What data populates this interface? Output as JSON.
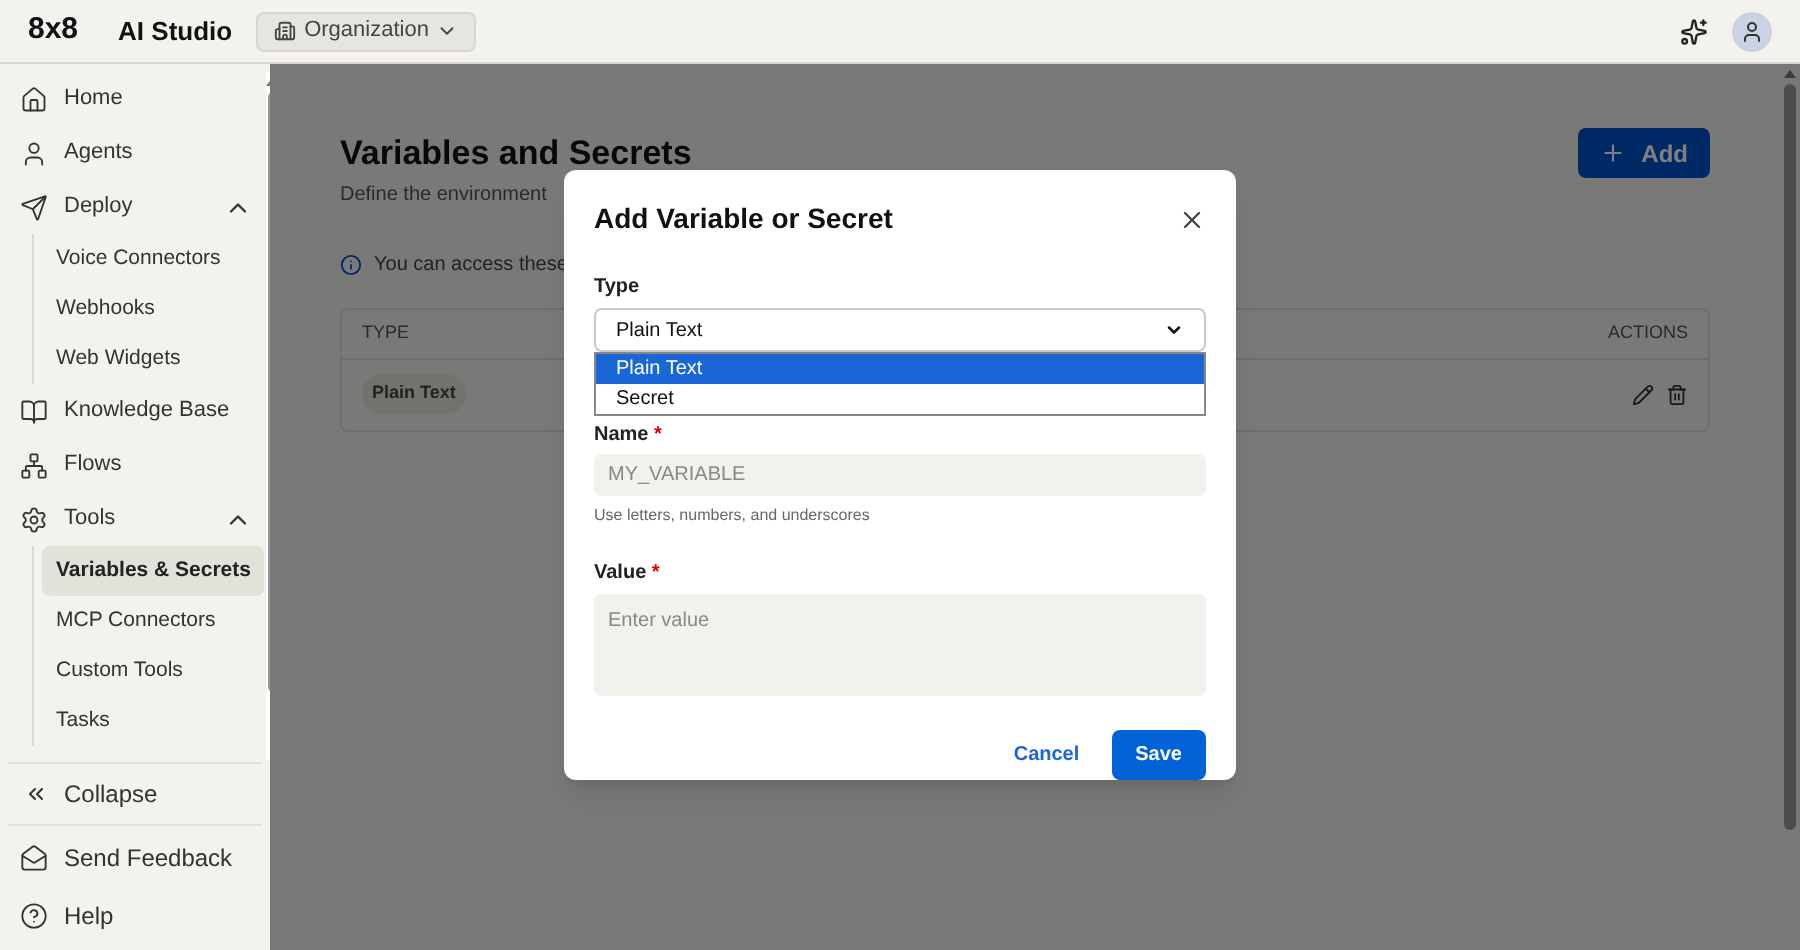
{
  "topbar": {
    "logo": "8x8",
    "app_name": "AI Studio",
    "org_selector": "Organization"
  },
  "sidebar": {
    "items": [
      {
        "label": "Home",
        "selected": false
      },
      {
        "label": "Agents",
        "selected": false
      },
      {
        "label": "Deploy",
        "selected": false,
        "expanded": true,
        "children": [
          {
            "label": "Voice Connectors",
            "selected": false
          },
          {
            "label": "Webhooks",
            "selected": false
          },
          {
            "label": "Web Widgets",
            "selected": false
          }
        ]
      },
      {
        "label": "Knowledge Base",
        "selected": false
      },
      {
        "label": "Flows",
        "selected": false
      },
      {
        "label": "Tools",
        "selected": false,
        "expanded": true,
        "children": [
          {
            "label": "Variables & Secrets",
            "selected": true
          },
          {
            "label": "MCP Connectors",
            "selected": false
          },
          {
            "label": "Custom Tools",
            "selected": false
          },
          {
            "label": "Tasks",
            "selected": false
          }
        ]
      }
    ],
    "collapse": "Collapse",
    "footer": [
      "Send Feedback",
      "Help"
    ]
  },
  "page": {
    "title": "Variables and Secrets",
    "subtitle": "Define the environment",
    "info": "You can access these",
    "add_button": "Add",
    "table": {
      "columns": [
        "TYPE",
        "ACTIONS"
      ],
      "rows": [
        {
          "type": "Plain Text"
        }
      ]
    }
  },
  "dialog": {
    "title": "Add Variable or Secret",
    "type_label": "Type",
    "type_value": "Plain Text",
    "type_options": [
      {
        "label": "Plain Text",
        "selected": true
      },
      {
        "label": "Secret",
        "selected": false
      }
    ],
    "name_label": "Name",
    "name_placeholder": "MY_VARIABLE",
    "name_hint": "Use letters, numbers, and underscores",
    "value_label": "Value",
    "value_placeholder": "Enter value",
    "required_mark": "*",
    "cancel": "Cancel",
    "save": "Save"
  }
}
